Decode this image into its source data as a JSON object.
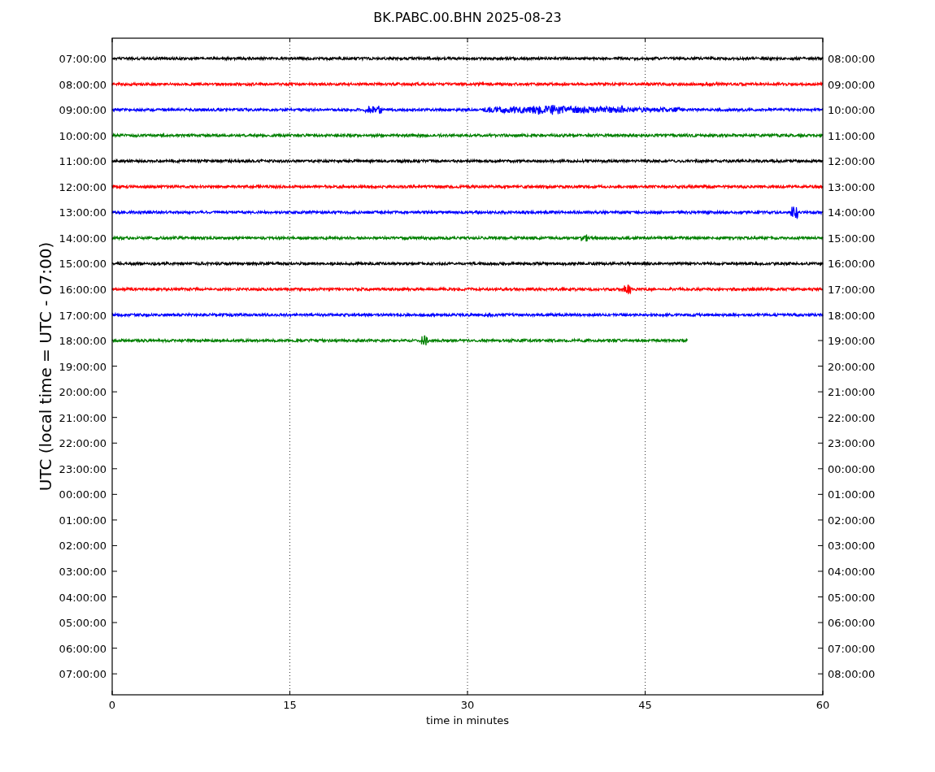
{
  "title": "BK.PABC.00.BHN 2025-08-23",
  "ylabel": "UTC (local time = UTC - 07:00)",
  "xlabel": "time in minutes",
  "xticks": [
    "0",
    "15",
    "30",
    "45",
    "60"
  ],
  "left_labels": [
    "07:00:00",
    "08:00:00",
    "09:00:00",
    "10:00:00",
    "11:00:00",
    "12:00:00",
    "13:00:00",
    "14:00:00",
    "15:00:00",
    "16:00:00",
    "17:00:00",
    "18:00:00",
    "19:00:00",
    "20:00:00",
    "21:00:00",
    "22:00:00",
    "23:00:00",
    "00:00:00",
    "01:00:00",
    "02:00:00",
    "03:00:00",
    "04:00:00",
    "05:00:00",
    "06:00:00",
    "07:00:00"
  ],
  "right_labels": [
    "08:00:00",
    "09:00:00",
    "10:00:00",
    "11:00:00",
    "12:00:00",
    "13:00:00",
    "14:00:00",
    "15:00:00",
    "16:00:00",
    "17:00:00",
    "18:00:00",
    "19:00:00",
    "20:00:00",
    "21:00:00",
    "22:00:00",
    "23:00:00",
    "00:00:00",
    "01:00:00",
    "02:00:00",
    "03:00:00",
    "04:00:00",
    "05:00:00",
    "06:00:00",
    "07:00:00",
    "08:00:00"
  ],
  "traces": [
    {
      "color": "#000000",
      "level": 1
    },
    {
      "color": "#ff0000",
      "level": 1
    },
    {
      "color": "#0000ff",
      "level": 1
    },
    {
      "color": "#008000",
      "level": 1
    },
    {
      "color": "#000000",
      "level": 1
    },
    {
      "color": "#ff0000",
      "level": 1
    },
    {
      "color": "#0000ff",
      "level": 1
    },
    {
      "color": "#008000",
      "level": 1
    },
    {
      "color": "#000000",
      "level": 1
    },
    {
      "color": "#ff0000",
      "level": 1
    },
    {
      "color": "#0000ff",
      "level": 1
    },
    {
      "color": "#008000",
      "level": 0.81
    }
  ]
}
